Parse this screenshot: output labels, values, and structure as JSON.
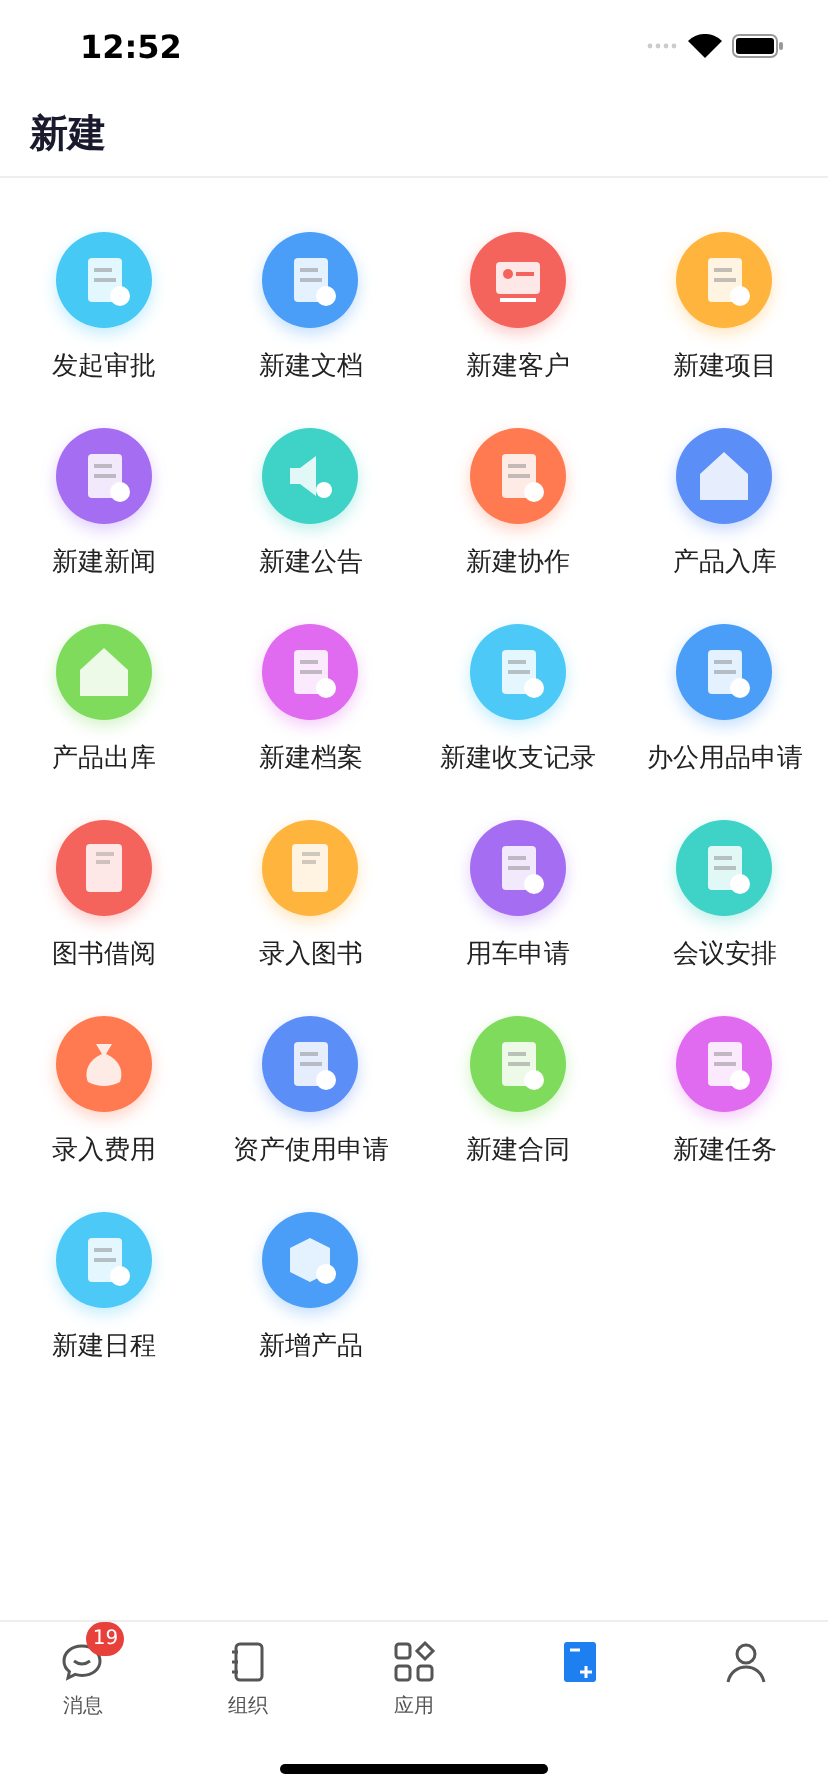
{
  "status_bar": {
    "time": "12:52"
  },
  "header": {
    "title": "新建"
  },
  "items": [
    {
      "label": "发起审批",
      "color": "#47c9f5"
    },
    {
      "label": "新建文档",
      "color": "#4a9ef7"
    },
    {
      "label": "新建客户",
      "color": "#f4645c"
    },
    {
      "label": "新建项目",
      "color": "#ffb43e"
    },
    {
      "label": "新建新闻",
      "color": "#a56ef2"
    },
    {
      "label": "新建公告",
      "color": "#3fd2c6"
    },
    {
      "label": "新建协作",
      "color": "#ff7a50"
    },
    {
      "label": "产品入库",
      "color": "#5b8ef7"
    },
    {
      "label": "产品出库",
      "color": "#7edb5c"
    },
    {
      "label": "新建档案",
      "color": "#e06af0"
    },
    {
      "label": "新建收支记录",
      "color": "#4cc9f6"
    },
    {
      "label": "办公用品申请",
      "color": "#4a9ef7"
    },
    {
      "label": "图书借阅",
      "color": "#f4645c"
    },
    {
      "label": "录入图书",
      "color": "#ffb43e"
    },
    {
      "label": "用车申请",
      "color": "#a56ef2"
    },
    {
      "label": "会议安排",
      "color": "#3fd2c6"
    },
    {
      "label": "录入费用",
      "color": "#ff7a50"
    },
    {
      "label": "资产使用申请",
      "color": "#5b8ef7"
    },
    {
      "label": "新建合同",
      "color": "#7edb5c"
    },
    {
      "label": "新建任务",
      "color": "#e06af0"
    },
    {
      "label": "新建日程",
      "color": "#4cc9f6"
    },
    {
      "label": "新增产品",
      "color": "#4a9ef7"
    }
  ],
  "tab_bar": [
    {
      "kind": "chat",
      "label": "消息",
      "badge": "19",
      "selected": false
    },
    {
      "kind": "notebook",
      "label": "组织",
      "selected": false
    },
    {
      "kind": "grid",
      "label": "应用",
      "selected": false
    },
    {
      "kind": "new",
      "selected": true
    },
    {
      "kind": "person",
      "selected": false
    }
  ]
}
